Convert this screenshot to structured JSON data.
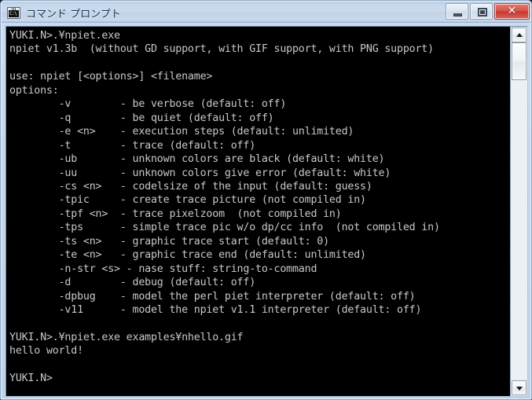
{
  "window": {
    "title": "コマンド プロンプト",
    "icon": "console-icon",
    "icon_text": "C:\\",
    "controls": {
      "minimize_label": "",
      "maximize_label": "",
      "close_label": "✕"
    }
  },
  "console": {
    "background_color": "#000000",
    "text_color": "#c8c8c8",
    "prompt": "YUKI.N>",
    "lines": [
      "YUKI.N>.¥npiet.exe",
      "npiet v1.3b  (without GD support, with GIF support, with PNG support)",
      "",
      "use: npiet [<options>] <filename>",
      "options:",
      "        -v        - be verbose (default: off)",
      "        -q        - be quiet (default: off)",
      "        -e <n>    - execution steps (default: unlimited)",
      "        -t        - trace (default: off)",
      "        -ub       - unknown colors are black (default: white)",
      "        -uu       - unknown colors give error (default: white)",
      "        -cs <n>   - codelsize of the input (default: guess)",
      "        -tpic     - create trace picture (not compiled in)",
      "        -tpf <n>  - trace pixelzoom  (not compiled in)",
      "        -tps      - simple trace pic w/o dp/cc info  (not compiled in)",
      "        -ts <n>   - graphic trace start (default: 0)",
      "        -te <n>   - graphic trace end (default: unlimited)",
      "        -n-str <s> - nase stuff: string-to-command",
      "        -d        - debug (default: off)",
      "        -dpbug    - model the perl piet interpreter (default: off)",
      "        -v11      - model the npiet v1.1 interpreter (default: off)",
      "",
      "YUKI.N>.¥npiet.exe examples¥nhello.gif",
      "hello world!",
      "",
      "YUKI.N>"
    ]
  },
  "scrollbar": {
    "up_arrow": "▲",
    "down_arrow": "▼"
  }
}
